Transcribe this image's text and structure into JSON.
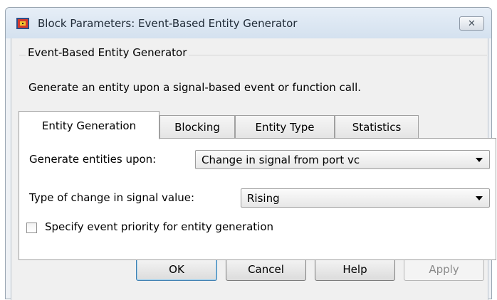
{
  "window": {
    "title": "Block Parameters: Event-Based Entity Generator",
    "close_glyph": "✕",
    "icon": "simulink-block-icon"
  },
  "block": {
    "group_label": "Event-Based Entity Generator",
    "description": "Generate an entity upon a signal-based event or function call."
  },
  "tabs": [
    {
      "label": "Entity Generation",
      "active": true
    },
    {
      "label": "Blocking",
      "active": false
    },
    {
      "label": "Entity Type",
      "active": false
    },
    {
      "label": "Statistics",
      "active": false
    }
  ],
  "params": {
    "generate_upon": {
      "label": "Generate entities upon:",
      "value": "Change in signal from port vc"
    },
    "type_of_change": {
      "label": "Type of change in signal value:",
      "value": "Rising"
    },
    "priority_checkbox": {
      "label": "Specify event priority for entity generation",
      "checked": false
    }
  },
  "buttons": {
    "ok": "OK",
    "cancel": "Cancel",
    "help": "Help",
    "apply": "Apply"
  },
  "colors": {
    "titlebar": "#d4e1ef",
    "dialog_bg": "#f0f0f0",
    "default_button_border": "#3c7fb1"
  }
}
